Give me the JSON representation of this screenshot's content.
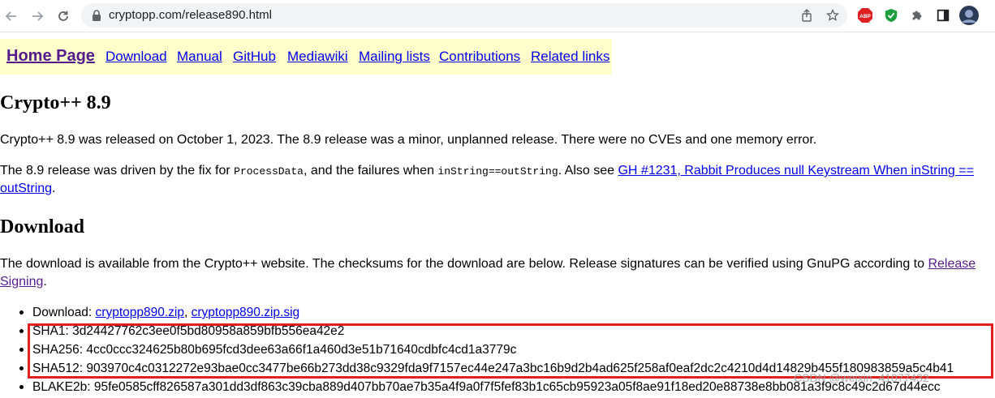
{
  "browser": {
    "url": "cryptopp.com/release890.html",
    "icons": [
      "back-icon",
      "forward-icon",
      "reload-icon",
      "lock-icon",
      "share-icon",
      "bookmark-star-icon",
      "adblock-plus-icon",
      "shield-extension-icon",
      "extensions-puzzle-icon",
      "side-panel-icon",
      "profile-avatar"
    ],
    "adblock_label": "ABP"
  },
  "navbar": {
    "home": "Home Page",
    "links": [
      "Download",
      "Manual",
      "GitHub",
      "Mediawiki",
      "Mailing lists",
      "Contributions",
      "Related links"
    ]
  },
  "page": {
    "title": "Crypto++ 8.9",
    "p1": "Crypto++ 8.9 was released on October 1, 2023. The 8.9 release was a minor, unplanned release. There were no CVEs and one memory error.",
    "p2": {
      "t1": "The 8.9 release was driven by the fix for ",
      "code1": "ProcessData",
      "t2": ", and the failures when ",
      "code2": "inString==outString",
      "t3": ". Also see ",
      "link1": "GH #1231, Rabbit Produces null Keystream When inString ==",
      "link2": "outString",
      "t4": "."
    },
    "download_heading": "Download",
    "p3": {
      "t1": "The download is available from the Crypto++ website. The checksums for the download are below. Release signatures can be verified using GnuPG according to ",
      "link1": "Release",
      "link2": "Signing",
      "t2": "."
    }
  },
  "downloads": {
    "label": "Download: ",
    "zip": "cryptopp890.zip",
    "sep": ", ",
    "sig": "cryptopp890.zip.sig",
    "sha1": "SHA1: 3d24427762c3ee0f5bd80958a859bfb556ea42e2",
    "sha256": "SHA256: 4cc0ccc324625b80b695fcd3dee63a66f1a460d3e51b71640cdbfc4cd1a3779c",
    "sha512": "SHA512: 903970c4c0312272e93bae0cc3477be66b273dd38c9329fda9f7157ec44e247a3bc16b9d2b4ad625f258af0eaf2dc2c4210d4d14829b455f180983859a5c4b41",
    "blake2b": "BLAKE2b: 95fe0585cff826587a301dd3df863c39cba889d407bb70ae7b35a4f9a0f7f5fef83b1c65cb95923a05f8ae91f18ed20e88738e8bb081a3f9c8c49c2d67d44ecc"
  },
  "annotation": {
    "highlight_color": "#e0201c",
    "watermark": "CSDN @weixin_41077432"
  },
  "colors": {
    "link": "#0000ee",
    "visited": "#551a8b",
    "navbar_bg": "#ffffcc"
  }
}
